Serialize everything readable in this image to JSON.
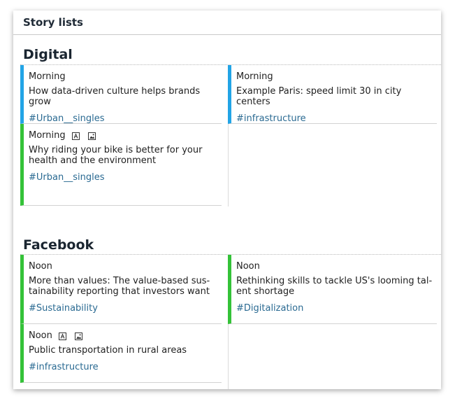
{
  "panel": {
    "title": "Story lists"
  },
  "sections": [
    {
      "title": "Digital",
      "cards": [
        {
          "time": "Morning",
          "title": "How data-driven culture helps brands grow",
          "tag": "#Urban__singles",
          "color": "#22a4e6",
          "icons": []
        },
        {
          "time": "Morning",
          "title": "Example Paris: speed limit 30 in city centers",
          "tag": "#infrastructure",
          "color": "#22a4e6",
          "icons": []
        },
        {
          "time": "Morning",
          "title": "Why riding your bike is better for your health and the environment",
          "tag": "#Urban__singles",
          "color": "#34c238",
          "icons": [
            "text-icon",
            "image-icon"
          ]
        }
      ]
    },
    {
      "title": "Facebook",
      "cards": [
        {
          "time": "Noon",
          "title": "More than values: The value-based sus­tainability reporting that investors want",
          "tag": "#Sustainability",
          "color": "#34c238",
          "icons": []
        },
        {
          "time": "Noon",
          "title": "Rethinking skills to tackle US's looming tal­ent shortage",
          "tag": "#Digitalization",
          "color": "#34c238",
          "icons": []
        },
        {
          "time": "Noon",
          "title": "Public transportation in rural areas",
          "tag": "#infrastructure",
          "color": "#34c238",
          "icons": [
            "text-icon",
            "image-icon"
          ]
        }
      ]
    }
  ]
}
